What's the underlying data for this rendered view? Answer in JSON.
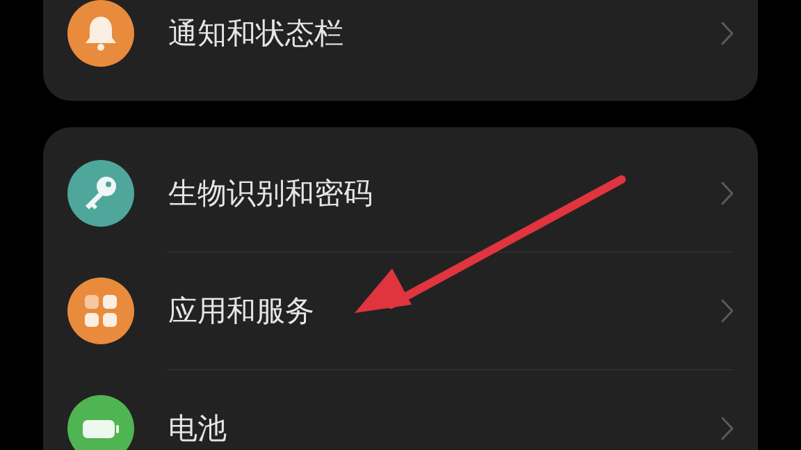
{
  "groups": [
    {
      "items": [
        {
          "label": "通知和状态栏",
          "kind": "bell",
          "color": "#e98b3c"
        }
      ]
    },
    {
      "items": [
        {
          "label": "生物识别和密码",
          "kind": "key",
          "color": "#4ea79a"
        },
        {
          "label": "应用和服务",
          "kind": "apps",
          "color": "#e98b3c"
        },
        {
          "label": "电池",
          "kind": "battery",
          "color": "#4fb552"
        }
      ]
    }
  ]
}
